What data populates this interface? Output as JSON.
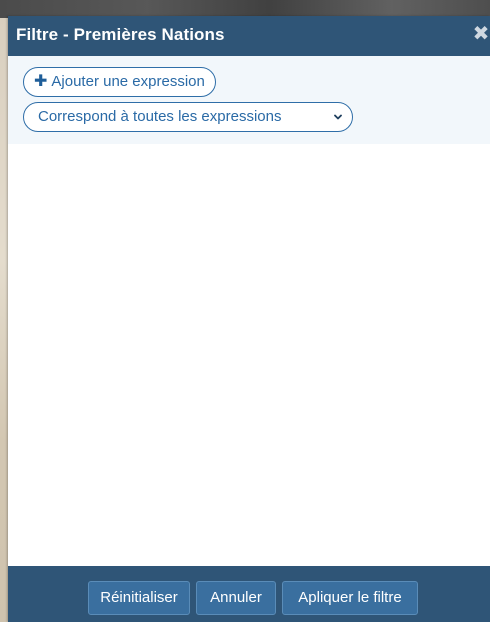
{
  "dialog": {
    "title": "Filtre - Premières Nations",
    "close_icon": "close-icon",
    "add_expression_label": "Ajouter une expression",
    "add_icon": "plus-icon",
    "match_select": {
      "selected": "Correspond à toutes les expressions",
      "icon": "chevron-down-icon"
    },
    "footer": {
      "reset_label": "Réinitialiser",
      "cancel_label": "Annuler",
      "apply_label": "Apliquer le filtre"
    }
  },
  "colors": {
    "header_bg": "#2f5577",
    "accent": "#2a6aa6",
    "button_bg": "#3a6f9f",
    "panel_bg": "#f2f7fb"
  }
}
